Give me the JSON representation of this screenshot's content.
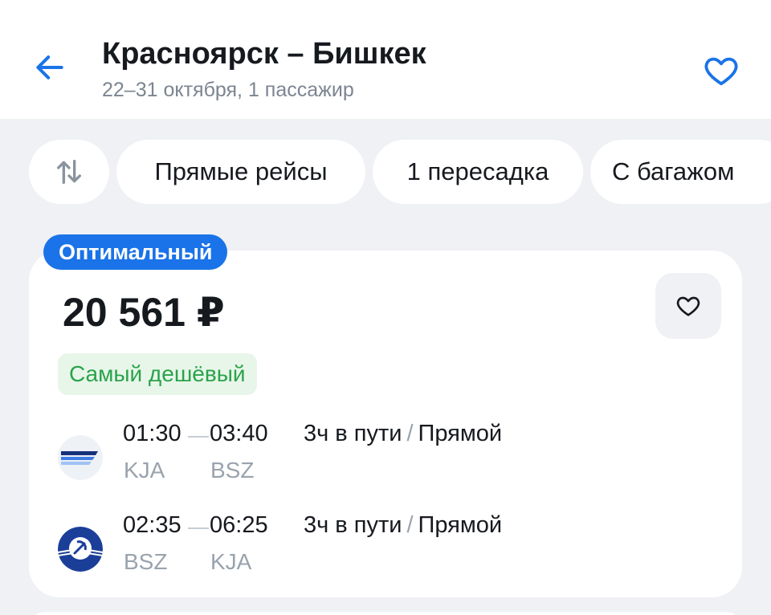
{
  "header": {
    "title": "Красноярск – Бишкек",
    "subtitle": "22–31 октября, 1 пассажир"
  },
  "filters": {
    "chips": [
      "Прямые рейсы",
      "1 пересадка",
      "С багажом"
    ]
  },
  "offer": {
    "badge": "Оптимальный",
    "price": "20 561 ₽",
    "tag": "Самый дешёвый",
    "segments": [
      {
        "airline_icon": "airline-logo-stripes",
        "depart_time": "01:30",
        "arrive_time": "03:40",
        "from": "KJA",
        "to": "BSZ",
        "duration": "3ч в пути",
        "separator": "/",
        "stops": "Прямой"
      },
      {
        "airline_icon": "airline-logo-aeroflot",
        "depart_time": "02:35",
        "arrive_time": "06:25",
        "from": "BSZ",
        "to": "KJA",
        "duration": "3ч в пути",
        "separator": "/",
        "stops": "Прямой"
      }
    ]
  },
  "colors": {
    "accent": "#1a73e8",
    "cheap_text": "#2aa34a",
    "cheap_bg": "#e8f6ea",
    "background": "#eff1f4"
  },
  "icons": {
    "back": "arrow-left-icon",
    "favorite": "heart-icon",
    "sort": "sort-arrows-icon"
  }
}
